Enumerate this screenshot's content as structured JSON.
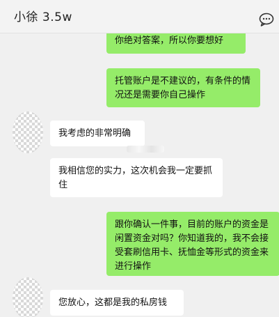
{
  "header": {
    "contact_name": "小徐  3.5w",
    "chat_icon": "chat-bubble-icon"
  },
  "messages": [
    {
      "side": "mine",
      "text": "你绝对答案，所以你要想好"
    },
    {
      "side": "mine",
      "text": "托管账户是不建议的，有条件的情况还是需要你自己操作"
    },
    {
      "side": "theirs",
      "text": "我考虑的非常明确"
    },
    {
      "side": "theirs",
      "text": "我相信您的实力，这次机会我一定要抓住"
    },
    {
      "side": "mine",
      "text": "跟你确认一件事，目前的账户的资金是闲置资金对吗？你知道我的，我不会接受套刷信用卡、抚恤金等形式的资金来进行操作"
    },
    {
      "side": "theirs",
      "text": "您放心，这都是我的私房钱"
    }
  ],
  "colors": {
    "mine_bubble": "#95ec69",
    "theirs_bubble": "#ffffff",
    "background": "#f0f0f0"
  }
}
